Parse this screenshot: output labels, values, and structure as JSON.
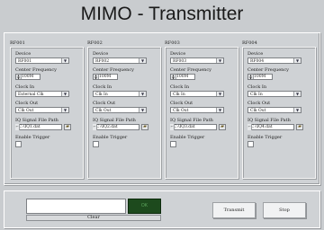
{
  "title": "MIMO - Transmitter",
  "groups": [
    {
      "label": "RF001",
      "device_label": "Device",
      "device": "RF001",
      "cf_label": "Center Frequency",
      "cf": "100M",
      "clock_in_label": "Clock In",
      "clock_in": "External Clk",
      "clock_out_label": "Clock Out",
      "clock_out": "Clk Out",
      "iq_label": "IQ Signal File Path",
      "iq_path": "C:\\IQ1.dat",
      "trigger_label": "Enable Trigger"
    },
    {
      "label": "RF002",
      "device_label": "Device",
      "device": "RF002",
      "cf_label": "Center Frequency",
      "cf": "100M",
      "clock_in_label": "Clock In",
      "clock_in": "Clk In",
      "clock_out_label": "Clock Out",
      "clock_out": "Clk Out",
      "iq_label": "IQ Signal File Path",
      "iq_path": "C:\\IQ2.dat",
      "trigger_label": "Enable Trigger"
    },
    {
      "label": "RF003",
      "device_label": "Device",
      "device": "RF003",
      "cf_label": "Center Frequency",
      "cf": "100M",
      "clock_in_label": "Clock In",
      "clock_in": "Clk In",
      "clock_out_label": "Clock Out",
      "clock_out": "Clk Out",
      "iq_label": "IQ Signal File Path",
      "iq_path": "C:\\IQ3.dat",
      "trigger_label": "Enable Trigger"
    },
    {
      "label": "RF004",
      "device_label": "Device",
      "device": "RF004",
      "cf_label": "Center Frequency",
      "cf": "100M",
      "clock_in_label": "Clock In",
      "clock_in": "Clk In",
      "clock_out_label": "Clock Out",
      "clock_out": "Clk Out",
      "iq_label": "IQ Signal File Path",
      "iq_path": "C:\\IQ4.dat",
      "trigger_label": "Enable Trigger"
    }
  ],
  "status": {
    "text": "",
    "ok_label": "OK",
    "clear_label": "Clear"
  },
  "buttons": {
    "transmit": "Transmit",
    "stop": "Stop"
  },
  "icons": {
    "dropdown": "chevron-down-icon",
    "spinner": "spinner-icon",
    "browse": "folder-icon",
    "path_symbol": "path-icon"
  },
  "colors": {
    "ok_led": "#1d4a1d",
    "background": "#c9cccf"
  }
}
